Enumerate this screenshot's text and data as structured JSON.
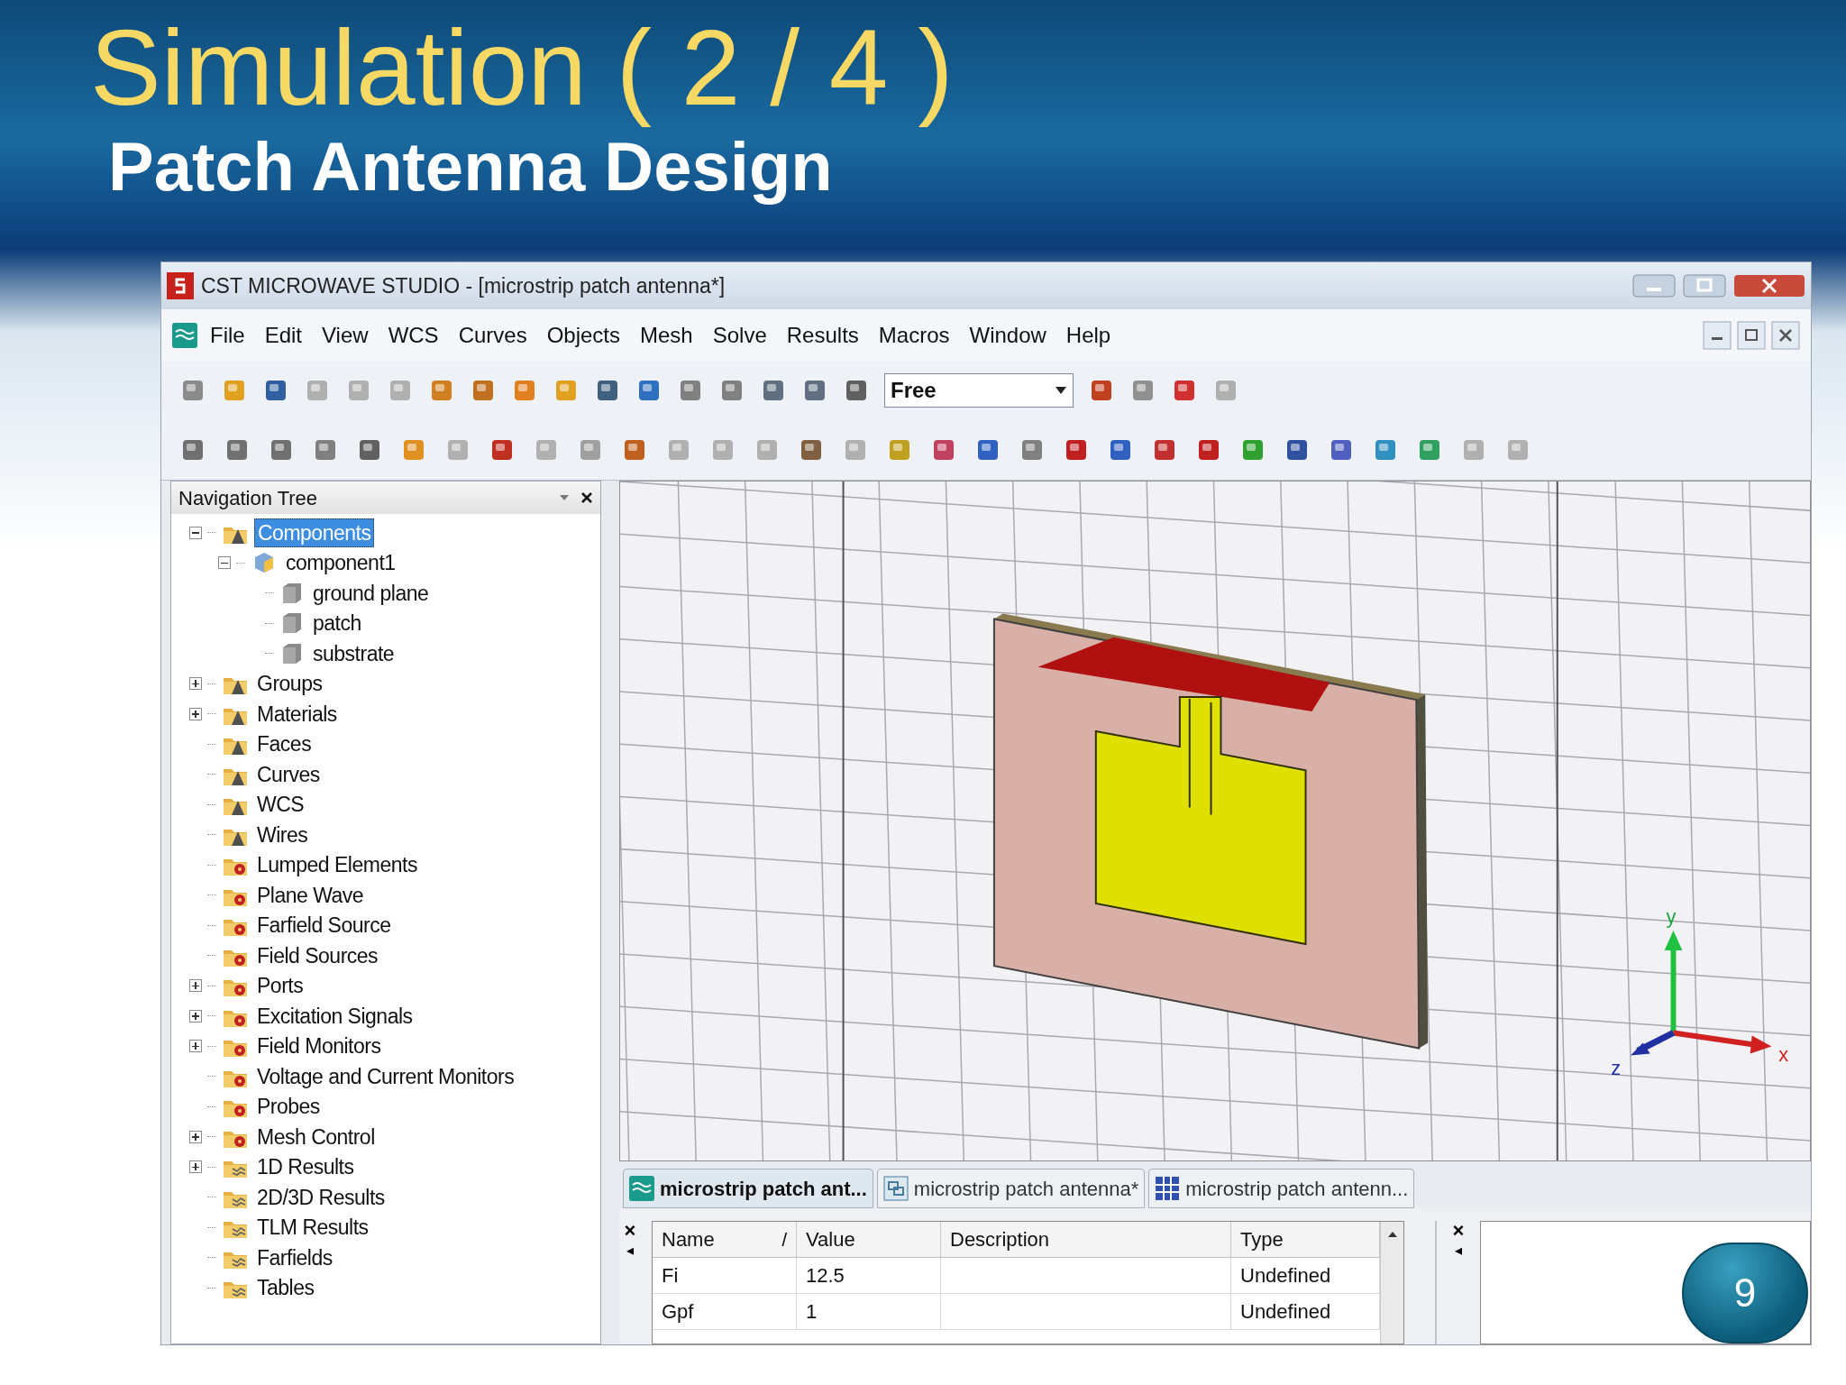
{
  "slide": {
    "title": "Simulation ( 2 / 4 )",
    "subtitle": "Patch Antenna Design",
    "page_number": "9"
  },
  "window": {
    "title": "CST MICROWAVE STUDIO - [microstrip patch antenna*]"
  },
  "menu": [
    "File",
    "Edit",
    "View",
    "WCS",
    "Curves",
    "Objects",
    "Mesh",
    "Solve",
    "Results",
    "Macros",
    "Window",
    "Help"
  ],
  "toolbar": {
    "mode_select": {
      "value": "Free"
    }
  },
  "navigation_tree": {
    "title": "Navigation Tree",
    "items": [
      {
        "label": "Components",
        "kind": "shape",
        "selected": true,
        "expanded": true,
        "children": [
          {
            "label": "component1",
            "kind": "component",
            "selected": false,
            "expanded": true,
            "children": [
              {
                "label": "ground plane",
                "kind": "solid",
                "selected": false
              },
              {
                "label": "patch",
                "kind": "solid",
                "selected": false
              },
              {
                "label": "substrate",
                "kind": "solid",
                "selected": false
              }
            ]
          }
        ]
      },
      {
        "label": "Groups",
        "kind": "shape",
        "selected": false,
        "expanded": false
      },
      {
        "label": "Materials",
        "kind": "shape",
        "selected": false,
        "expanded": false
      },
      {
        "label": "Faces",
        "kind": "shape",
        "selected": false
      },
      {
        "label": "Curves",
        "kind": "shape",
        "selected": false
      },
      {
        "label": "WCS",
        "kind": "shape",
        "selected": false
      },
      {
        "label": "Wires",
        "kind": "shape",
        "selected": false
      },
      {
        "label": "Lumped Elements",
        "kind": "gear",
        "selected": false
      },
      {
        "label": "Plane Wave",
        "kind": "gear",
        "selected": false
      },
      {
        "label": "Farfield Source",
        "kind": "gear",
        "selected": false
      },
      {
        "label": "Field Sources",
        "kind": "gear",
        "selected": false
      },
      {
        "label": "Ports",
        "kind": "gear",
        "selected": false,
        "expanded": false
      },
      {
        "label": "Excitation Signals",
        "kind": "gear",
        "selected": false,
        "expanded": false
      },
      {
        "label": "Field Monitors",
        "kind": "gear",
        "selected": false,
        "expanded": false
      },
      {
        "label": "Voltage and Current Monitors",
        "kind": "gear",
        "selected": false
      },
      {
        "label": "Probes",
        "kind": "gear",
        "selected": false
      },
      {
        "label": "Mesh Control",
        "kind": "gear",
        "selected": false,
        "expanded": false
      },
      {
        "label": "1D Results",
        "kind": "results",
        "selected": false,
        "expanded": false
      },
      {
        "label": "2D/3D Results",
        "kind": "results",
        "selected": false
      },
      {
        "label": "TLM Results",
        "kind": "results",
        "selected": false
      },
      {
        "label": "Farfields",
        "kind": "results",
        "selected": false
      },
      {
        "label": "Tables",
        "kind": "results",
        "selected": false
      }
    ]
  },
  "viewport": {
    "axes": [
      "x",
      "y",
      "z"
    ]
  },
  "document_tabs": [
    {
      "label": "microstrip patch ant...",
      "kind": "wave",
      "selected": true
    },
    {
      "label": "microstrip patch antenna*",
      "kind": "schematic",
      "selected": false
    },
    {
      "label": "microstrip patch antenn...",
      "kind": "grid",
      "selected": false
    }
  ],
  "parameter_table": {
    "columns": [
      "Name",
      "Value",
      "Description",
      "Type"
    ],
    "sort_mark": "/",
    "rows": [
      [
        "Fi",
        "12.5",
        "",
        "Undefined"
      ],
      [
        "Gpf",
        "1",
        "",
        "Undefined"
      ]
    ]
  },
  "panel_controls": {
    "close": "×",
    "left": "◂"
  }
}
